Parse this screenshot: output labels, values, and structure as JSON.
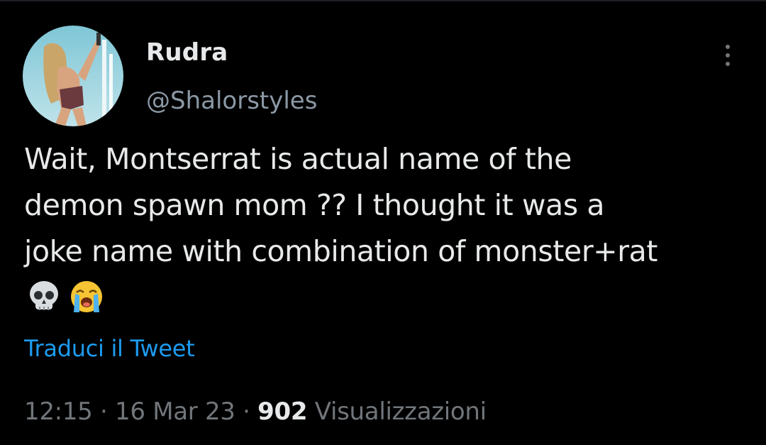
{
  "author": {
    "display_name": "Rudra",
    "handle": "@Shalorstyles"
  },
  "tweet": {
    "line1": "Wait, Montserrat is actual name of the",
    "line2": "demon spawn mom ?? I thought it was a",
    "line3": "joke name with combination of monster+rat",
    "emojis": [
      "skull-emoji",
      "loudly-crying-face-emoji"
    ]
  },
  "actions": {
    "translate_label": "Traduci il Tweet",
    "more_icon": "more-vertical-icon"
  },
  "meta": {
    "time": "12:15",
    "separator": "·",
    "date": "16 Mar 23",
    "views_count": "902",
    "views_label": "Visualizzazioni"
  },
  "colors": {
    "background": "#000000",
    "primary_text": "#e7e9ea",
    "secondary_text": "#71767b",
    "link": "#1d9bf0"
  }
}
